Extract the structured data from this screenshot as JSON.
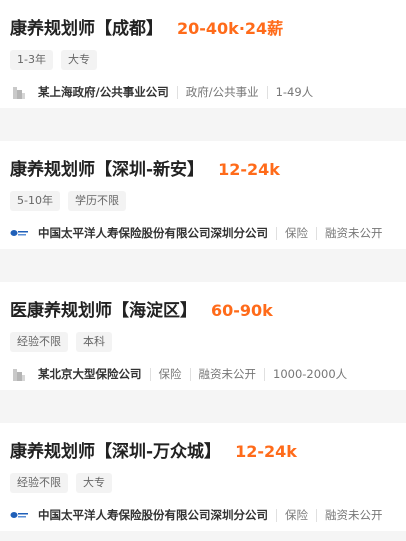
{
  "jobs": [
    {
      "title": "康养规划师【成都】",
      "salary": "20-40k·24薪",
      "tags": [
        "1-3年",
        "大专"
      ],
      "company": "某上海政府/公共事业公司",
      "logo": "building-logo-icon",
      "meta": [
        "政府/公共事业",
        "1-49人"
      ]
    },
    {
      "title": "康养规划师【深圳-新安】",
      "salary": "12-24k",
      "tags": [
        "5-10年",
        "学历不限"
      ],
      "company": "中国太平洋人寿保险股份有限公司深圳分公司",
      "logo": "cpic-logo-icon",
      "meta": [
        "保险",
        "融资未公开"
      ]
    },
    {
      "title": "医康养规划师【海淀区】",
      "salary": "60-90k",
      "tags": [
        "经验不限",
        "本科"
      ],
      "company": "某北京大型保险公司",
      "logo": "building-logo-icon",
      "meta": [
        "保险",
        "融资未公开",
        "1000-2000人"
      ]
    },
    {
      "title": "康养规划师【深圳-万众城】",
      "salary": "12-24k",
      "tags": [
        "经验不限",
        "大专"
      ],
      "company": "中国太平洋人寿保险股份有限公司深圳分公司",
      "logo": "cpic-logo-icon",
      "meta": [
        "保险",
        "融资未公开"
      ]
    }
  ],
  "colors": {
    "salary": "#ff6b1a",
    "title": "#222222",
    "background": "#f5f5f5",
    "card": "#ffffff"
  }
}
